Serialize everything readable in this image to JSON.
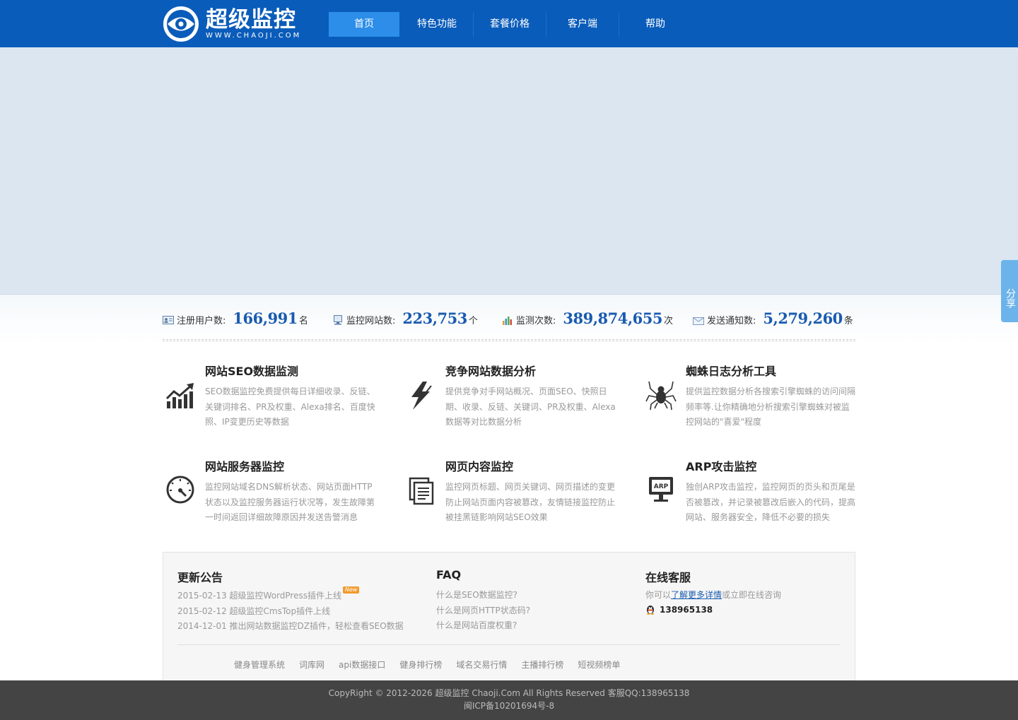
{
  "header": {
    "logo_cn": "超级监控",
    "logo_en": "WWW.CHAOJI.COM",
    "nav": [
      "首页",
      "特色功能",
      "套餐价格",
      "客户端",
      "帮助"
    ]
  },
  "share_label": "分享",
  "stats": [
    {
      "label": "注册用户数:",
      "value": "166,991",
      "unit": "名",
      "icon": "user-card-icon"
    },
    {
      "label": "监控网站数:",
      "value": "223,753",
      "unit": "个",
      "icon": "monitor-icon"
    },
    {
      "label": "监测次数:",
      "value": "389,874,655",
      "unit": "次",
      "icon": "bar-chart-icon"
    },
    {
      "label": "发送通知数:",
      "value": "5,279,260",
      "unit": "条",
      "icon": "envelope-icon"
    }
  ],
  "features": [
    {
      "title": "网站SEO数据监测",
      "desc": "SEO数据监控免费提供每日详细收录、反链、关键词排名、PR及权重、Alexa排名、百度快照、IP变更历史等数据",
      "icon": "trend-chart-icon"
    },
    {
      "title": "竞争网站数据分析",
      "desc": "提供竞争对手网站概况、页面SEO、快照日期、收录、反链、关键词、PR及权重、Alexa数据等对比数据分析",
      "icon": "lightning-icon"
    },
    {
      "title": "蜘蛛日志分析工具",
      "desc": "提供监控数据分析各搜索引擎蜘蛛的访问间隔频率等.让你精确地分析搜索引擎蜘蛛对被监控网站的\"喜爱\"程度",
      "icon": "spider-icon"
    },
    {
      "title": "网站服务器监控",
      "desc": "监控网站域名DNS解析状态、网站页面HTTP状态以及监控服务器运行状况等，发生故障第一时间返回详细故障原因并发送告警消息",
      "icon": "gauge-icon"
    },
    {
      "title": "网页内容监控",
      "desc": "监控网页标题、网页关键词、网页描述的变更防止网站页面内容被篡改，友情链接监控防止被挂黑链影响网站SEO效果",
      "icon": "document-icon"
    },
    {
      "title": "ARP攻击监控",
      "desc": "独创ARP攻击监控，监控网页的页头和页尾是否被篡改，并记录被篡改后嵌入的代码，提高网站、服务器安全，降低不必要的损失",
      "icon": "arp-monitor-icon"
    }
  ],
  "news": {
    "title": "更新公告",
    "badge": "New",
    "items": [
      "2015-02-13 超级监控WordPress插件上线",
      "2015-02-12 超级监控CmsTop插件上线",
      "2014-12-01 推出网站数据监控DZ插件，轻松查看SEO数据"
    ]
  },
  "faq": {
    "title": "FAQ",
    "items": [
      "什么是SEO数据监控?",
      "什么是网页HTTP状态码?",
      "什么是网站百度权重?"
    ]
  },
  "service": {
    "title": "在线客服",
    "pre": "你可以",
    "link": "了解更多详情",
    "post": "或立即在线咨询",
    "qq": "138965138"
  },
  "friend_links": [
    "健身管理系统",
    "词库网",
    "api数据接口",
    "健身排行榜",
    "域名交易行情",
    "主播排行榜",
    "短视频榜单"
  ],
  "footer": {
    "line1": "CopyRight © 2012-2026 超级监控 Chaoji.Com All Rights Reserved 客服QQ:138965138",
    "line2": "闽ICP备10201694号-8"
  },
  "colors": {
    "brand_blue": "#0a5cba",
    "nav_active": "#2c8ee8",
    "stat_value": "#1a5bb0"
  }
}
